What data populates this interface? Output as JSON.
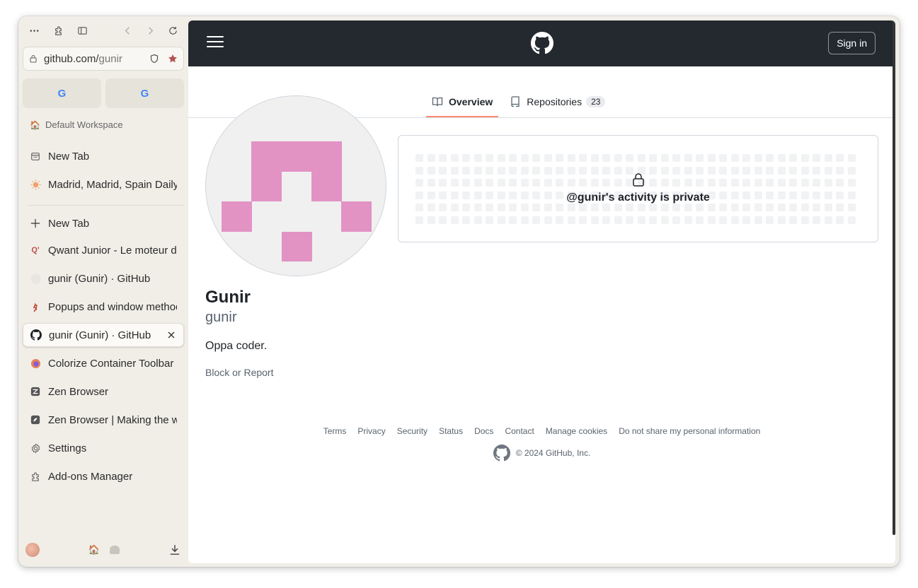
{
  "browser": {
    "url_host": "github.com/",
    "url_path": "gunir",
    "workspace": "Default Workspace",
    "pinned_tabs": [
      {
        "icon": "google-icon"
      },
      {
        "icon": "google-icon"
      }
    ],
    "essential_tabs": [
      {
        "label": "New Tab",
        "icon": "calendar-icon"
      },
      {
        "label": "Madrid, Madrid, Spain Daily",
        "icon": "sun-icon"
      }
    ],
    "new_tab_label": "New Tab",
    "tabs": [
      {
        "label": "Qwant Junior - Le moteur de",
        "icon": "qwant-icon"
      },
      {
        "label": "gunir (Gunir) · GitHub",
        "icon": "github-icon"
      },
      {
        "label": "Popups and window methods",
        "icon": "mdn-icon"
      },
      {
        "label": "gunir (Gunir) · GitHub",
        "icon": "github-icon",
        "active": true
      },
      {
        "label": "Colorize Container Toolbar -",
        "icon": "firefox-icon"
      },
      {
        "label": "Zen Browser",
        "icon": "zen-icon"
      },
      {
        "label": "Zen Browser | Making the web",
        "icon": "zen-docs-icon"
      },
      {
        "label": "Settings",
        "icon": "gear-icon"
      },
      {
        "label": "Add-ons Manager",
        "icon": "puzzle-icon"
      }
    ]
  },
  "github": {
    "sign_in": "Sign in",
    "nav": {
      "overview": "Overview",
      "repositories": "Repositories",
      "repo_count": "23"
    },
    "activity_private": "@gunir's activity is private",
    "profile": {
      "name": "Gunir",
      "login": "gunir",
      "bio": "Oppa coder.",
      "block_report": "Block or Report"
    },
    "footer": {
      "links": [
        "Terms",
        "Privacy",
        "Security",
        "Status",
        "Docs",
        "Contact",
        "Manage cookies",
        "Do not share my personal information"
      ],
      "copyright": "© 2024 GitHub, Inc."
    }
  },
  "colors": {
    "header_bg": "#24292f",
    "avatar_pink": "#e293c4",
    "tab_underline": "#fd8c73",
    "sidebar_bg": "#f0eee7"
  }
}
